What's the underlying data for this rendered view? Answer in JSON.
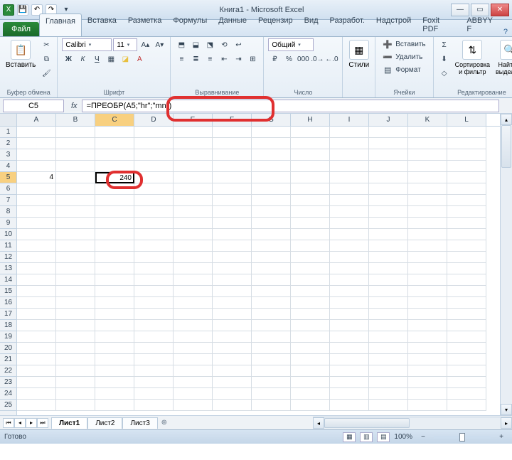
{
  "title": "Книга1 - Microsoft Excel",
  "qat": {
    "excel": "X",
    "save": "💾",
    "undo": "↶",
    "redo": "↷",
    "dd": "▾"
  },
  "tabs": {
    "file": "Файл",
    "items": [
      "Главная",
      "Вставка",
      "Разметка",
      "Формулы",
      "Данные",
      "Рецензир",
      "Вид",
      "Разработ.",
      "Надстрой",
      "Foxit PDF",
      "ABBYY F"
    ],
    "active": 0,
    "help": "?"
  },
  "ribbon": {
    "clipboard": {
      "paste": "Вставить",
      "label": "Буфер обмена"
    },
    "font": {
      "name": "Calibri",
      "size": "11",
      "label": "Шрифт"
    },
    "align": {
      "label": "Выравнивание"
    },
    "number": {
      "fmt": "Общий",
      "label": "Число"
    },
    "styles": {
      "btn": "Стили",
      "label": ""
    },
    "cells": {
      "insert": "Вставить",
      "delete": "Удалить",
      "format": "Формат",
      "label": "Ячейки"
    },
    "editing": {
      "sort": "Сортировка и фильтр",
      "find": "Найти и выделить",
      "label": "Редактирование"
    }
  },
  "formula_bar": {
    "cell_ref": "C5",
    "fx": "fx",
    "formula": "=ПРЕОБР(A5;\"hr\";\"mn\")"
  },
  "grid": {
    "columns": [
      "A",
      "B",
      "C",
      "D",
      "E",
      "F",
      "G",
      "H",
      "I",
      "J",
      "K",
      "L"
    ],
    "row_count": 25,
    "active": {
      "row": 5,
      "col": "C"
    },
    "cells": {
      "A5": "4",
      "C5": "240"
    }
  },
  "sheets": {
    "tabs": [
      "Лист1",
      "Лист2",
      "Лист3"
    ],
    "active": 0
  },
  "status": {
    "ready": "Готово",
    "zoom": "100%",
    "zoom_minus": "−",
    "zoom_plus": "+"
  },
  "win": {
    "min": "—",
    "max": "▭",
    "close": "✕"
  }
}
